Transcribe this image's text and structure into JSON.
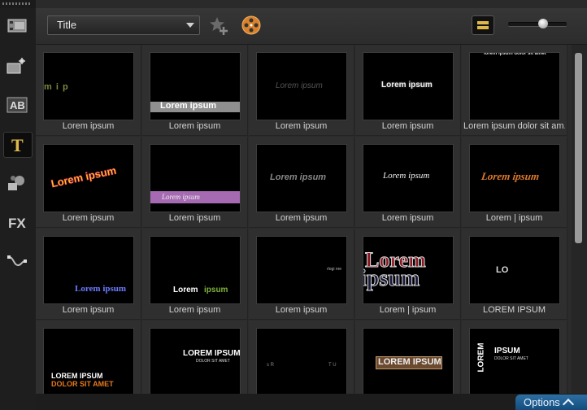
{
  "toolbar": {
    "category_value": "Title",
    "zoom_level": 0.6
  },
  "sidebar": {
    "items": [
      {
        "name": "media"
      },
      {
        "name": "transition"
      },
      {
        "name": "ab-text"
      },
      {
        "name": "title",
        "active": true
      },
      {
        "name": "graphic"
      },
      {
        "name": "fx"
      },
      {
        "name": "path"
      }
    ],
    "fx_label": "FX"
  },
  "titles": [
    {
      "caption": "Lorem ipsum",
      "text": "m    i    p",
      "style": "scatter"
    },
    {
      "caption": "Lorem ipsum",
      "text": "Lorem ipsum",
      "style": "lowerthird-gray"
    },
    {
      "caption": "Lorem ipsum",
      "text": "Lorem ipsum",
      "style": "faint"
    },
    {
      "caption": "Lorem ipsum",
      "text": "Lorem ipsum",
      "style": "bold-white"
    },
    {
      "caption": "Lorem ipsum dolor sit am...",
      "text": "lorem ipsum dolor sit amet",
      "style": "tiny-top"
    },
    {
      "caption": "Lorem ipsum",
      "text": "Lorem ipsum",
      "style": "rainbow"
    },
    {
      "caption": "Lorem ipsum",
      "text": "Lorem ipsum",
      "style": "lowerthird-purple"
    },
    {
      "caption": "Lorem ipsum",
      "text": "Lorem ipsum",
      "style": "gray-italic"
    },
    {
      "caption": "Lorem ipsum",
      "text": "Lorem ipsum",
      "style": "serif-white"
    },
    {
      "caption": "Lorem | ipsum",
      "text": "Lorem ipsum",
      "style": "orange-script"
    },
    {
      "caption": "Lorem ipsum",
      "text": "Lorem ipsum",
      "style": "blue"
    },
    {
      "caption": "Lorem ipsum",
      "text": "Lorem",
      "text2": "ipsum",
      "style": "white-green"
    },
    {
      "caption": "Lorem ipsum",
      "text": "rlogi nre",
      "style": "tiny-right"
    },
    {
      "caption": "Lorem | ipsum",
      "text": "Lorem",
      "text2": "ipsum",
      "style": "big-split"
    },
    {
      "caption": "LOREM IPSUM",
      "text": "LO",
      "style": "lo"
    },
    {
      "caption": "",
      "text": "LOREM IPSUM",
      "text2": "DOLOR SIT AMET",
      "style": "stack-orange"
    },
    {
      "caption": "",
      "text": "LOREM IPSUM",
      "text2": "DOLOR SIT AMET",
      "style": "stack-right"
    },
    {
      "caption": "",
      "text": "s R",
      "text2": "T U",
      "style": "scatter2"
    },
    {
      "caption": "",
      "text": "LOREM IPSUM",
      "style": "boxed"
    },
    {
      "caption": "",
      "text": "LOREM",
      "text2": "IPSUM",
      "text3": "DOLOR SIT AMET",
      "style": "vertical"
    }
  ],
  "footer": {
    "options_label": "Options"
  },
  "colors": {
    "accent": "#e0b84a",
    "options_blue": "#1f5f94",
    "panel": "#2b2b2b"
  }
}
